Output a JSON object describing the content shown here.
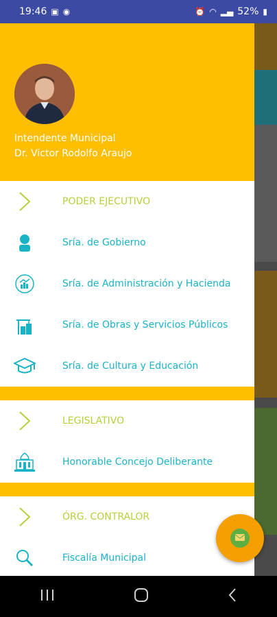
{
  "status_bar": {
    "time": "19:46",
    "battery": "52%"
  },
  "header": {
    "title": "Intendente Municipal",
    "name": "Dr. Victor Rodolfo Araujo"
  },
  "menu": {
    "ejecutivo": {
      "section": "PODER EJECUTIVO",
      "items": [
        "Sría. de Gobierno",
        "Sría. de Administración y Hacienda",
        "Sría. de Obras y Servicios Públicos",
        "Sría. de Cultura y Educación"
      ]
    },
    "legislativo": {
      "section": "LEGISLATIVO",
      "items": [
        "Honorable Concejo Deliberante"
      ]
    },
    "contralor": {
      "section": "ÓRG. CONTRALOR",
      "items": [
        "Fiscalía Municipal"
      ]
    }
  },
  "colors": {
    "accent": "#ffbf00",
    "item_text": "#1ab3c5",
    "section_text": "#b3d23a",
    "fab": "#f5a000"
  }
}
